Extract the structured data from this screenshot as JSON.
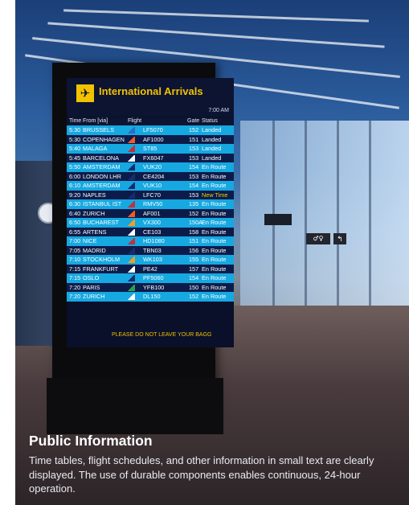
{
  "board": {
    "title": "International Arrivals",
    "time": "7:00 AM",
    "columns": {
      "time": "Time",
      "from": "From [via]",
      "flight": "Flight",
      "gate": "Gate",
      "status": "Status"
    },
    "flights": [
      {
        "time": "5:30",
        "from": "BRUSSELS",
        "flight": "LF5070",
        "gate": "152",
        "status": "Landed",
        "row_color": "cyan",
        "logo_color": "#2a6cc8"
      },
      {
        "time": "5:30",
        "from": "COPENHAGEN",
        "flight": "AF1000",
        "gate": "151",
        "status": "Landed",
        "row_color": "navy",
        "logo_color": "#f05a28"
      },
      {
        "time": "5:40",
        "from": "MALAGA",
        "flight": "ST85",
        "gate": "153",
        "status": "Landed",
        "row_color": "cyan",
        "logo_color": "#c0303c"
      },
      {
        "time": "5:45",
        "from": "BARCELONA",
        "flight": "FX6047",
        "gate": "153",
        "status": "Landed",
        "row_color": "navy",
        "logo_color": "#ffffff"
      },
      {
        "time": "5:50",
        "from": "AMSTERDAM",
        "flight": "VUK20",
        "gate": "154",
        "status": "En Route",
        "row_color": "cyan",
        "logo_color": "#1a2a6c"
      },
      {
        "time": "6:00",
        "from": "LONDON LHR",
        "flight": "CE4204",
        "gate": "153",
        "status": "En Route",
        "row_color": "navy",
        "logo_color": "#1a2a6c"
      },
      {
        "time": "6:10",
        "from": "AMSTERDAM",
        "flight": "VUK10",
        "gate": "154",
        "status": "En Route",
        "row_color": "cyan",
        "logo_color": "#1a2a6c"
      },
      {
        "time": "9:20",
        "from": "NAPLES",
        "flight": "LFC70",
        "gate": "153",
        "status": "New Time",
        "row_color": "navy",
        "logo_color": "#1a2a6c"
      },
      {
        "time": "6:30",
        "from": "ISTANBUL IST",
        "flight": "RMV50",
        "gate": "135",
        "status": "En Route",
        "row_color": "cyan",
        "logo_color": "#c0303c"
      },
      {
        "time": "6:40",
        "from": "ZURICH",
        "flight": "AF001",
        "gate": "152",
        "status": "En Route",
        "row_color": "navy",
        "logo_color": "#f05a28"
      },
      {
        "time": "6:50",
        "from": "BUCHAREST",
        "flight": "VX300",
        "gate": "150A",
        "status": "En Route",
        "row_color": "cyan",
        "logo_color": "#f0a020"
      },
      {
        "time": "6:55",
        "from": "ARTENS",
        "flight": "CE103",
        "gate": "158",
        "status": "En Route",
        "row_color": "navy",
        "logo_color": "#ffffff"
      },
      {
        "time": "7:00",
        "from": "NICE",
        "flight": "HD1080",
        "gate": "151",
        "status": "En Route",
        "row_color": "cyan",
        "logo_color": "#c0303c"
      },
      {
        "time": "7:05",
        "from": "MADRID",
        "flight": "TBN03",
        "gate": "156",
        "status": "En Route",
        "row_color": "navy",
        "logo_color": "#1a2a6c"
      },
      {
        "time": "7:10",
        "from": "STOCKHOLM",
        "flight": "WK103",
        "gate": "155",
        "status": "En Route",
        "row_color": "cyan",
        "logo_color": "#f0a020"
      },
      {
        "time": "7:15",
        "from": "FRANKFURT",
        "flight": "PE42",
        "gate": "157",
        "status": "En Route",
        "row_color": "navy",
        "logo_color": "#ffffff"
      },
      {
        "time": "7:15",
        "from": "OSLO",
        "flight": "PF5060",
        "gate": "154",
        "status": "En Route",
        "row_color": "cyan",
        "logo_color": "#1a2a6c"
      },
      {
        "time": "7:20",
        "from": "PARIS",
        "flight": "YFB100",
        "gate": "150",
        "status": "En Route",
        "row_color": "navy",
        "logo_color": "#2aa050"
      },
      {
        "time": "7:20",
        "from": "ZURICH",
        "flight": "DL150",
        "gate": "152",
        "status": "En Route",
        "row_color": "cyan",
        "logo_color": "#ffffff"
      }
    ],
    "footer": "PLEASE DO NOT LEAVE YOUR BAGG"
  },
  "caption": {
    "title": "Public Information",
    "text": "Time tables, flight schedules, and other information in small text are clearly displayed. The use of durable components enables continuous, 24-hour operation."
  },
  "colors": {
    "accent_yellow": "#f2c200",
    "row_cyan": "#16a8e0",
    "row_navy": "#0c1c4a",
    "new_time": "#f2d000"
  },
  "icons": {
    "board_icon": "airplane-icon"
  }
}
